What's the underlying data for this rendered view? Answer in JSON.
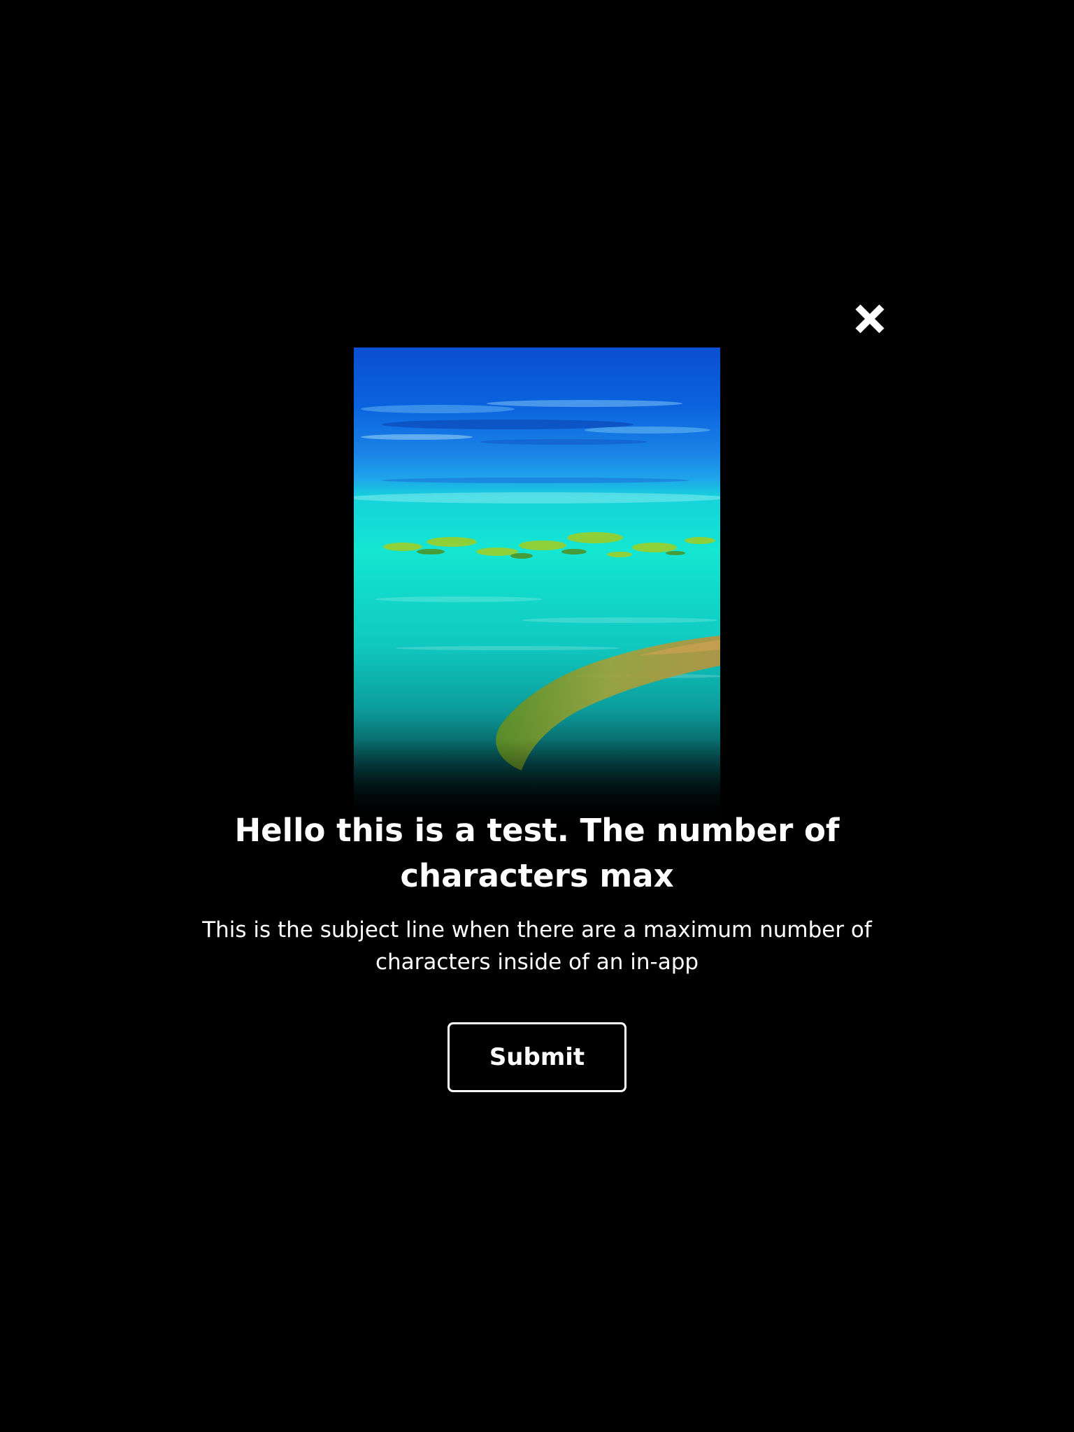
{
  "modal": {
    "close_icon": "close-icon",
    "hero_image": "aerial-reef-image",
    "title": "Hello this is a test. The number of characters max",
    "subtitle": "This is the subject line when there are a maximum number of characters inside of an in-app",
    "submit_label": "Submit"
  },
  "colors": {
    "background": "#000000",
    "text": "#ffffff",
    "button_border": "#ffffff",
    "ocean_deep": "#0a55d6",
    "ocean_shallow": "#12e0d0",
    "reef": "#9ccf2a"
  }
}
